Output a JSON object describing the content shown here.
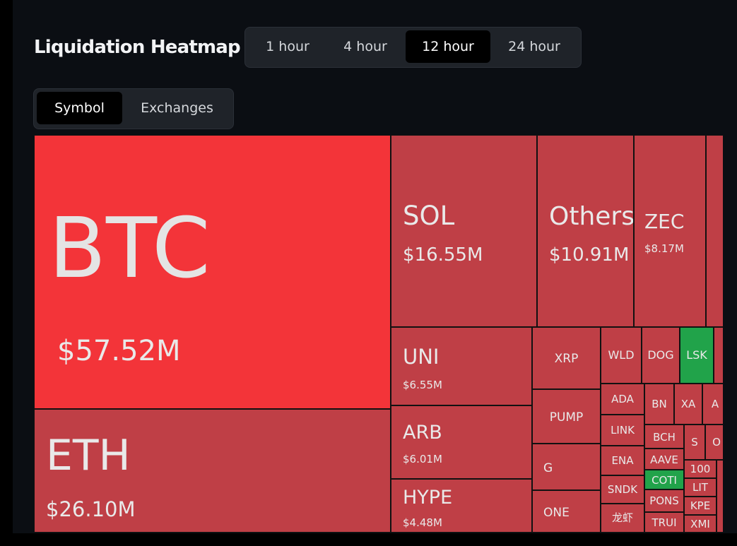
{
  "header": {
    "title": "Liquidation Heatmap",
    "timeframes": [
      "1 hour",
      "4 hour",
      "12 hour",
      "24 hour"
    ],
    "active_timeframe": "12 hour"
  },
  "view_tabs": {
    "items": [
      "Symbol",
      "Exchanges"
    ],
    "active": "Symbol"
  },
  "colors": {
    "background": "#0b0e13",
    "tile_red": "#bf3f46",
    "tile_bright_red": "#f33439",
    "tile_green": "#21a34a",
    "text": "#e9e9e9"
  },
  "tiles": {
    "btc": {
      "symbol": "BTC",
      "value": "$57.52M"
    },
    "eth": {
      "symbol": "ETH",
      "value": "$26.10M"
    },
    "sol": {
      "symbol": "SOL",
      "value": "$16.55M"
    },
    "others": {
      "symbol": "Others",
      "value": "$10.91M"
    },
    "zec": {
      "symbol": "ZEC",
      "value": "$8.17M"
    },
    "uni": {
      "symbol": "UNI",
      "value": "$6.55M"
    },
    "arb": {
      "symbol": "ARB",
      "value": "$6.01M"
    },
    "hype": {
      "symbol": "HYPE",
      "value": "$4.48M"
    },
    "xrp": {
      "symbol": "XRP"
    },
    "pump": {
      "symbol": "PUMP"
    },
    "g": {
      "symbol": "G"
    },
    "one": {
      "symbol": "ONE"
    },
    "wld": {
      "symbol": "WLD"
    },
    "dog": {
      "symbol": "DOG"
    },
    "lsk": {
      "symbol": "LSK"
    },
    "ada": {
      "symbol": "ADA"
    },
    "link": {
      "symbol": "LINK"
    },
    "ena": {
      "symbol": "ENA"
    },
    "sndk": {
      "symbol": "SNDK"
    },
    "longxia": {
      "symbol": "龙虾"
    },
    "bn": {
      "symbol": "BN"
    },
    "xa": {
      "symbol": "XA"
    },
    "a": {
      "symbol": "A"
    },
    "bch": {
      "symbol": "BCH"
    },
    "s": {
      "symbol": "S"
    },
    "o": {
      "symbol": "O"
    },
    "aave": {
      "symbol": "AAVE"
    },
    "coti": {
      "symbol": "COTI"
    },
    "k100": {
      "symbol": "100"
    },
    "lit": {
      "symbol": "LIT"
    },
    "pons": {
      "symbol": "PONS"
    },
    "kpe": {
      "symbol": "KPE"
    },
    "trui": {
      "symbol": "TRUI"
    },
    "xmi": {
      "symbol": "XMI"
    }
  }
}
